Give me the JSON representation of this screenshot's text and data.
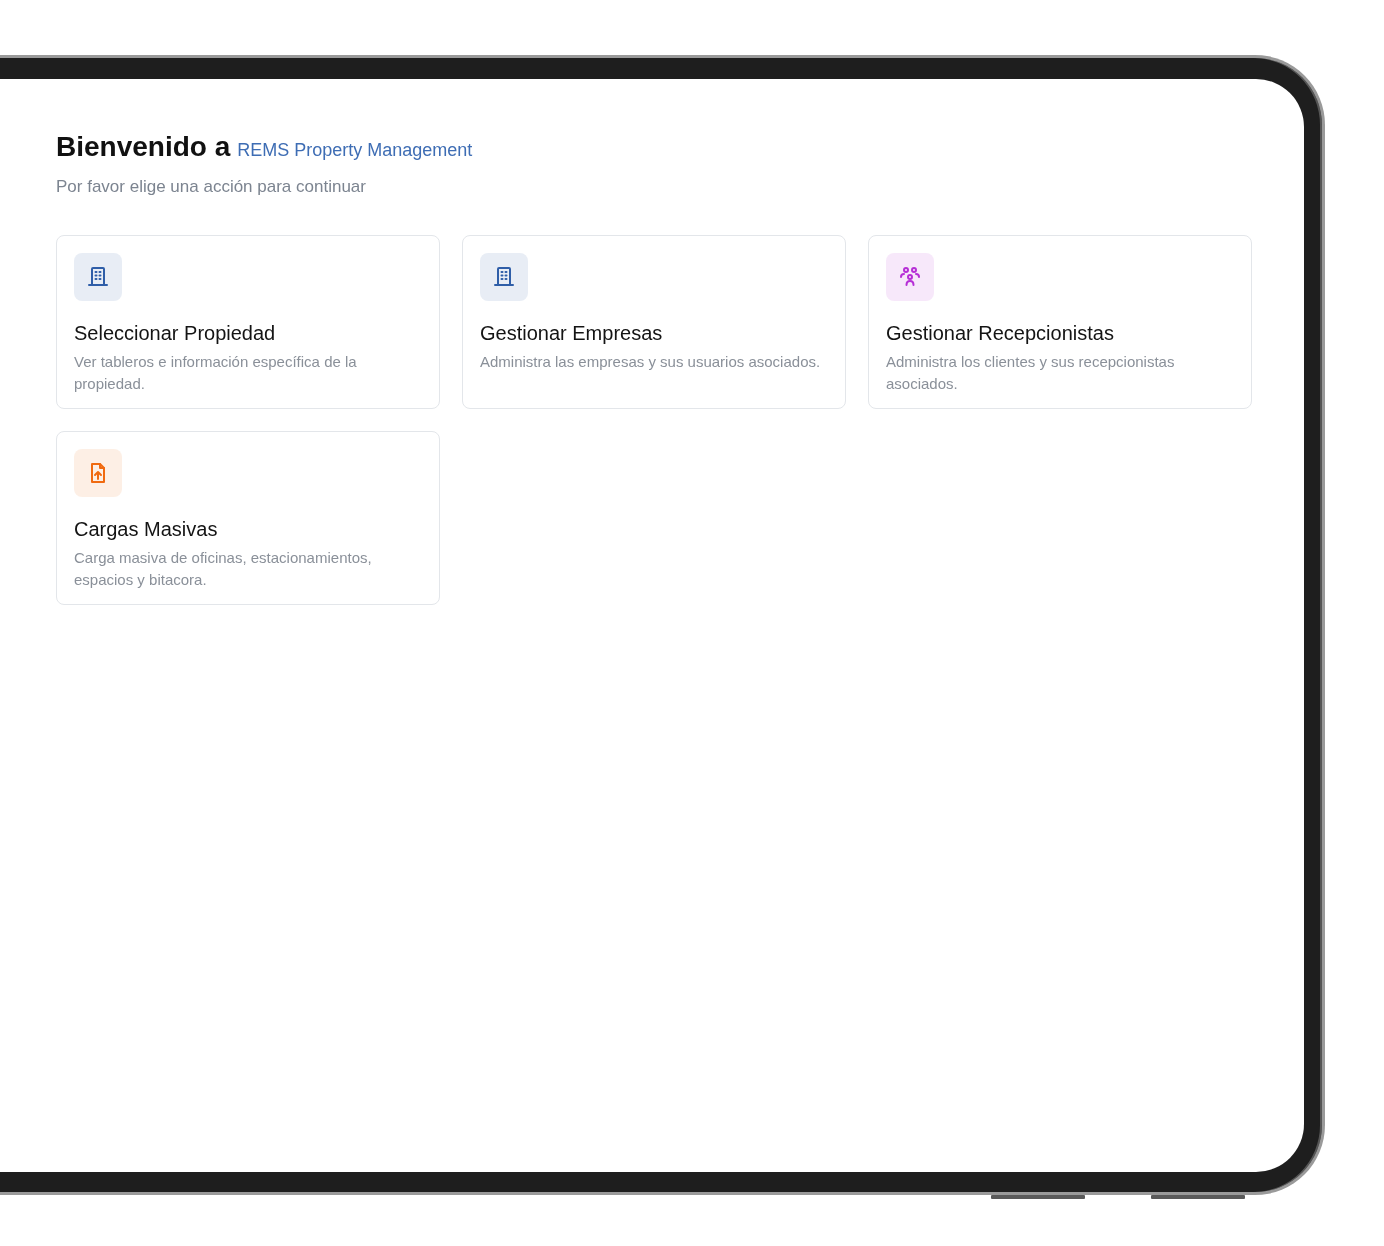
{
  "header": {
    "title": "Bienvenido a",
    "brand": "REMS Property Management",
    "subtitle": "Por favor elige una acción para continuar"
  },
  "cards": [
    {
      "kind": "building",
      "color": "#2f5ea8",
      "title": "Seleccionar Propiedad",
      "description": "Ver tableros e información específica de la propiedad."
    },
    {
      "kind": "building",
      "color": "#2f5ea8",
      "title": "Gestionar Empresas",
      "description": "Administra las empresas y sus usuarios asociados."
    },
    {
      "kind": "people",
      "color": "#b62fd6",
      "title": "Gestionar Recepcionistas",
      "description": "Administra los clientes y sus recepcionistas asociados."
    },
    {
      "kind": "upload",
      "color": "#f06a10",
      "title": "Cargas Masivas",
      "description": "Carga masiva de oficinas, estacionamientos, espacios y bitacora."
    }
  ]
}
